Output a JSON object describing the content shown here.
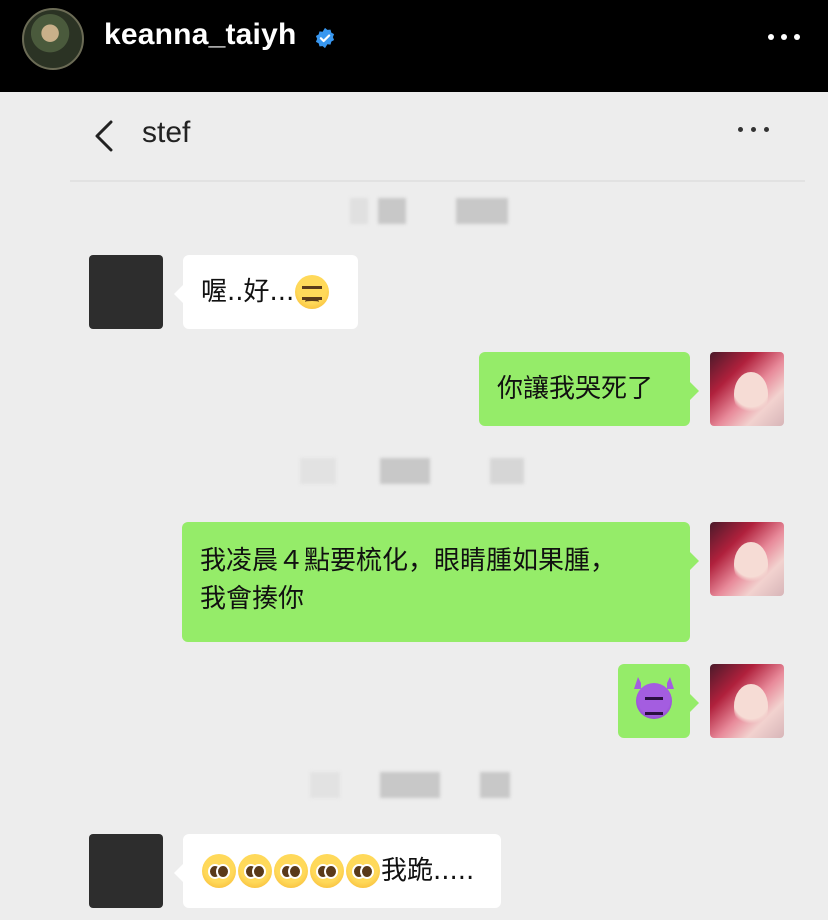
{
  "instagram": {
    "username": "keanna_taiyh",
    "verified": true,
    "more_icon": "more-horizontal-icon"
  },
  "chat": {
    "header": {
      "title": "stef",
      "back_icon": "chevron-left-icon",
      "more_icon": "more-horizontal-icon"
    },
    "messages": [
      {
        "side": "left",
        "text": "喔..好...",
        "emoji": [
          "confounded-face"
        ]
      },
      {
        "side": "right",
        "text": "你讓我哭死了",
        "emoji": []
      },
      {
        "side": "right",
        "line1": "我凌晨４點要梳化，眼睛腫如果腫，",
        "line2": "我會揍你",
        "emoji": []
      },
      {
        "side": "right",
        "text": "",
        "emoji": [
          "angry-devil-face"
        ]
      },
      {
        "side": "left",
        "text": "我跪.....",
        "emoji": [
          "pleading-face",
          "pleading-face",
          "pleading-face",
          "pleading-face",
          "pleading-face"
        ]
      }
    ],
    "colors": {
      "background": "#ededed",
      "sent_bubble": "#95ec69",
      "received_bubble": "#ffffff"
    }
  }
}
